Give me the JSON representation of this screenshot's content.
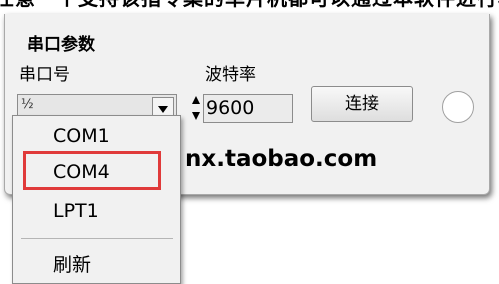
{
  "top_strip_text": "任意一个支持该指令集的单片机都可以通过本软件进行程序下载，无论是什么",
  "panel": {
    "section_title": "串口参数",
    "port_label": "串口号",
    "baud_label": "波特率",
    "port_combo_text": "½",
    "baud_value": "9600",
    "connect_label": "连接",
    "link_text": "nx.taobao.com"
  },
  "dropdown": {
    "options": [
      "COM1",
      "COM4",
      "LPT1"
    ],
    "refresh_label": "刷新",
    "highlighted_option": "COM4"
  },
  "colors": {
    "highlight": "#e03a3a",
    "panel_bg": "#f1f1f1"
  }
}
